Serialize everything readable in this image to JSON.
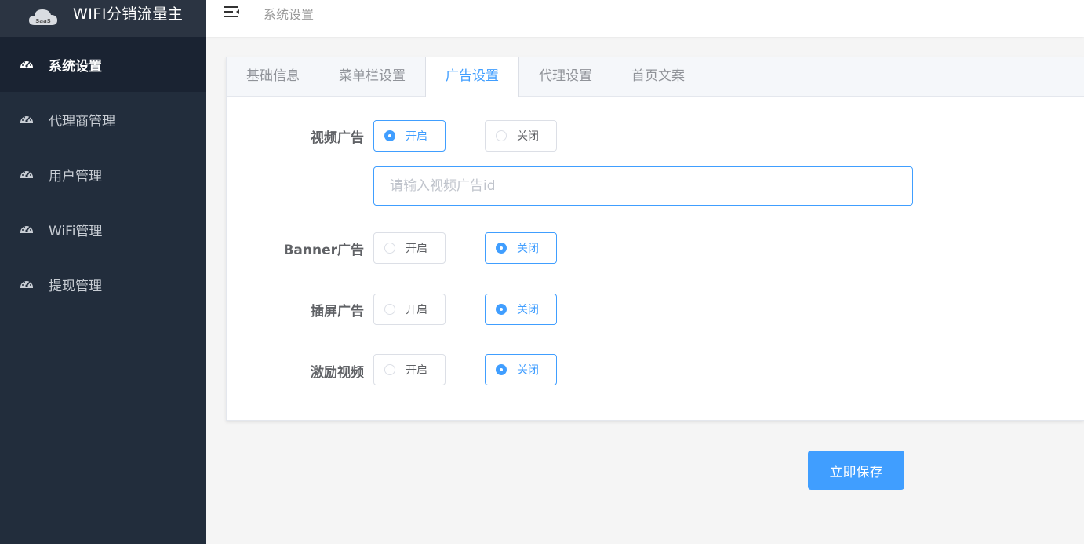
{
  "app": {
    "title": "WIFI分销流量主",
    "logo_text": "SaaS"
  },
  "sidebar": {
    "items": [
      {
        "label": "系统设置",
        "icon": "dashboard-icon",
        "active": true
      },
      {
        "label": "代理商管理",
        "icon": "dashboard-icon",
        "active": false
      },
      {
        "label": "用户管理",
        "icon": "dashboard-icon",
        "active": false
      },
      {
        "label": "WiFi管理",
        "icon": "dashboard-icon",
        "active": false
      },
      {
        "label": "提现管理",
        "icon": "dashboard-icon",
        "active": false
      }
    ]
  },
  "header": {
    "breadcrumb": "系统设置"
  },
  "tabs": [
    {
      "label": "基础信息",
      "active": false
    },
    {
      "label": "菜单栏设置",
      "active": false
    },
    {
      "label": "广告设置",
      "active": true
    },
    {
      "label": "代理设置",
      "active": false
    },
    {
      "label": "首页文案",
      "active": false
    }
  ],
  "form": {
    "video_ad": {
      "label": "视频广告",
      "on_label": "开启",
      "off_label": "关闭",
      "selected": "on",
      "input_value": "",
      "input_placeholder": "请输入视频广告id"
    },
    "banner_ad": {
      "label": "Banner广告",
      "on_label": "开启",
      "off_label": "关闭",
      "selected": "off"
    },
    "interstitial_ad": {
      "label": "插屏广告",
      "on_label": "开启",
      "off_label": "关闭",
      "selected": "off"
    },
    "reward_video": {
      "label": "激励视频",
      "on_label": "开启",
      "off_label": "关闭",
      "selected": "off"
    }
  },
  "actions": {
    "save_label": "立即保存"
  },
  "colors": {
    "sidebar_bg": "#222d3c",
    "accent": "#409eff"
  }
}
